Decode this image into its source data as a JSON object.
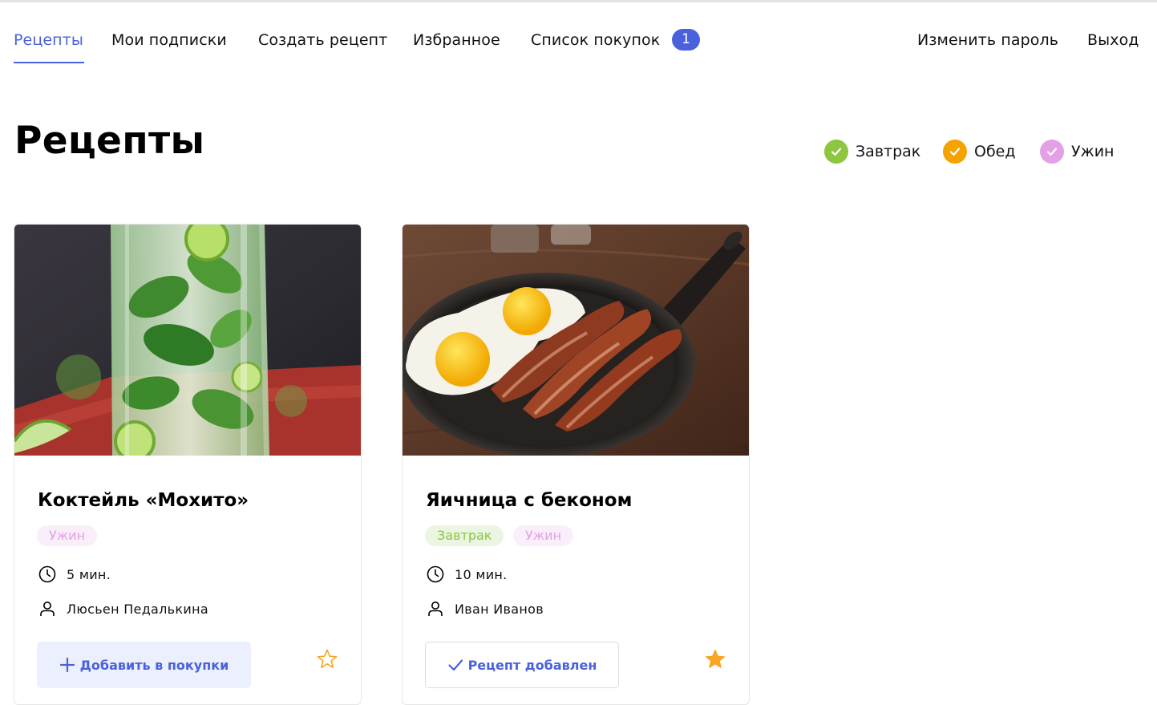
{
  "nav": {
    "items": [
      {
        "label": "Рецепты",
        "active": true
      },
      {
        "label": "Мои подписки"
      },
      {
        "label": "Создать рецепт"
      },
      {
        "label": "Избранное"
      },
      {
        "label": "Список покупок",
        "badge": "1"
      }
    ],
    "right": [
      {
        "label": "Изменить пароль"
      },
      {
        "label": "Выход"
      }
    ]
  },
  "page": {
    "title": "Рецепты"
  },
  "filters": [
    {
      "label": "Завтрак",
      "color": "#8dc63f",
      "checked": true
    },
    {
      "label": "Обед",
      "color": "#f5a300",
      "checked": true
    },
    {
      "label": "Ужин",
      "color": "#e3a0e5",
      "checked": true
    }
  ],
  "cards": [
    {
      "title": "Коктейль «Мохито»",
      "tags": [
        "Ужин"
      ],
      "time": "5 мин.",
      "author": "Люсьен Педалькина",
      "button_label": "Добавить в покупки",
      "button_icon": "plus-icon",
      "favorite": false,
      "image": "mojito-cocktail-photo"
    },
    {
      "title": "Яичница с беконом",
      "tags": [
        "Завтрак",
        "Ужин"
      ],
      "time": "10 мин.",
      "author": "Иван Иванов",
      "button_label": "Рецепт добавлен",
      "button_icon": "check-icon",
      "favorite": true,
      "image": "eggs-bacon-pan-photo"
    }
  ],
  "colors": {
    "accent": "#4a61dd",
    "breakfast": "#8dc63f",
    "lunch": "#f5a300",
    "dinner": "#e3a0e5",
    "star": "#f5a623"
  }
}
